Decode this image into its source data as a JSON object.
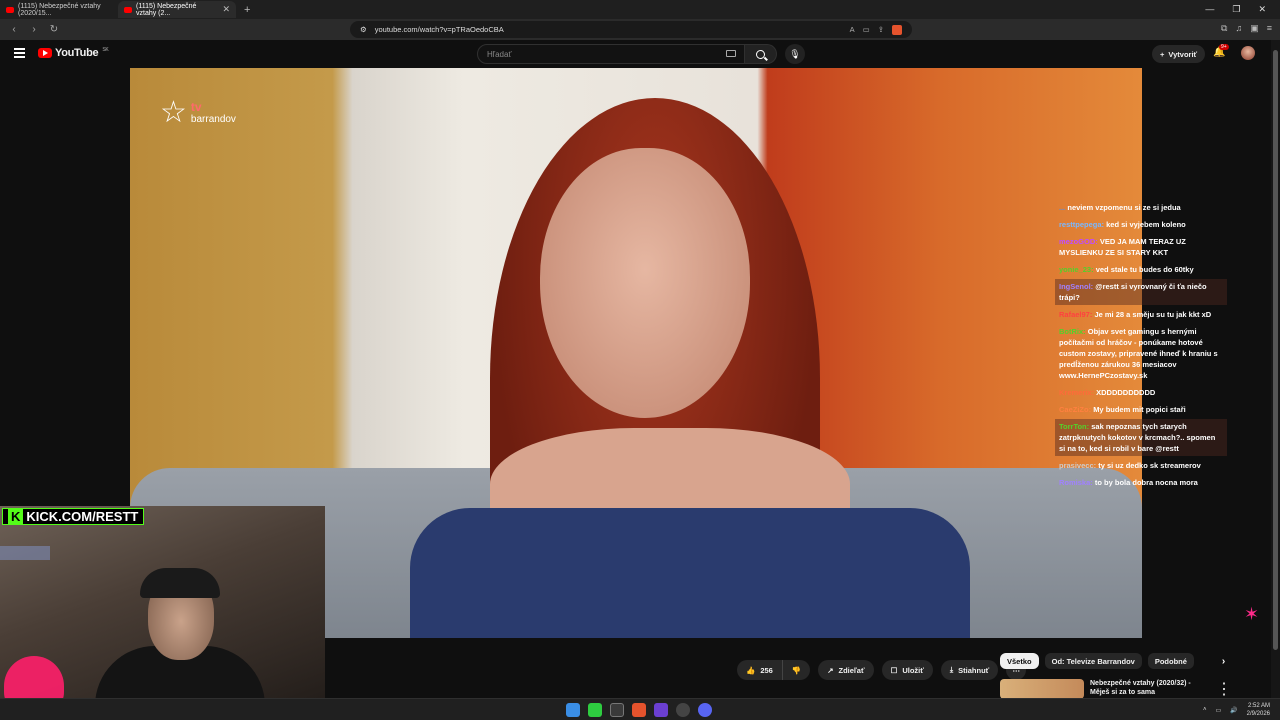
{
  "browser": {
    "tabs": [
      {
        "label": "(1115) Nebezpečné vztahy (2020/15..."
      },
      {
        "label": "(1115) Nebezpečné vztahy (2..."
      }
    ],
    "url": "youtube.com/watch?v=pTRaOedoCBA"
  },
  "youtube": {
    "logo_text": "YouTube",
    "region": "SK",
    "search_placeholder": "Hľadať",
    "create_label": "Vytvoriť",
    "notif_badge": "9+"
  },
  "video": {
    "channel_logo_tv": "tv",
    "channel_logo_name": "barrandov"
  },
  "chat": [
    {
      "user": "...",
      "text": "neviem vzpomenu si ze si jedua",
      "user_color": "#5a8fe0",
      "highlight": false
    },
    {
      "user": "resttpepega:",
      "text": "ked si vyjebem koleno",
      "user_color": "#7ab8ff",
      "highlight": false
    },
    {
      "user": "mezoGOD:",
      "text": "VED JA MAM TERAZ UZ MYSLIENKU ZE SI STARY KKT",
      "user_color": "#c04bff",
      "highlight": false
    },
    {
      "user": "yonie_23:",
      "text": "ved stale tu budes do 60tky",
      "user_color": "#53d12a",
      "highlight": false
    },
    {
      "user": "IngSenol:",
      "text": "@restt si vyrovnaný či ťa niečo trápi?",
      "user_color": "#a080ff",
      "highlight": true
    },
    {
      "user": "Rafael97:",
      "text": "Je mi 28 a směju su tu jak kkt xD",
      "user_color": "#ff4040",
      "highlight": false
    },
    {
      "user": "BotRix:",
      "text": "Objav svet gamingu s hernými počítačmi od hráčov - ponúkame hotové custom zostavy, pripravené ihneď k hraniu s predĺženou zárukou 36 mesiacov www.HernePCzostavy.sk",
      "user_color": "#53d12a",
      "highlight": false
    },
    {
      "user": "Kremerix:",
      "text": "XDDDDDDDDDD",
      "user_color": "#ff6a3a",
      "highlight": false
    },
    {
      "user": "CaeZiZo:",
      "text": "My budem mit popici staři",
      "user_color": "#ff8040",
      "highlight": false
    },
    {
      "user": "TorrTon:",
      "text": "sak nepoznas tych starych zatrpknutych kokotov v krcmach?.. spomen si na to, ked si robil v bare @restt",
      "user_color": "#53d12a",
      "highlight": true
    },
    {
      "user": "prasivecc:",
      "text": "ty si uz dedko       sk streamerov",
      "user_color": "#cccccc",
      "highlight": false
    },
    {
      "user": "Romiska:",
      "text": "to by bola dobra nocna mora",
      "user_color": "#a080ff",
      "highlight": false
    }
  ],
  "overlay": {
    "kick_label": "KICK.COM/RESTT"
  },
  "actions": {
    "likes": "256",
    "share": "Zdieľať",
    "save": "Uložiť",
    "download": "Stiahnuť"
  },
  "chips": [
    "Všetko",
    "Od: Televize Barrandov",
    "Podobné"
  ],
  "recommendation": {
    "title": "Nebezpečné vztahy (2020/32) - Měješ si za to sama"
  },
  "taskbar": {
    "time": "2:52 AM",
    "date": "2/9/2026"
  }
}
